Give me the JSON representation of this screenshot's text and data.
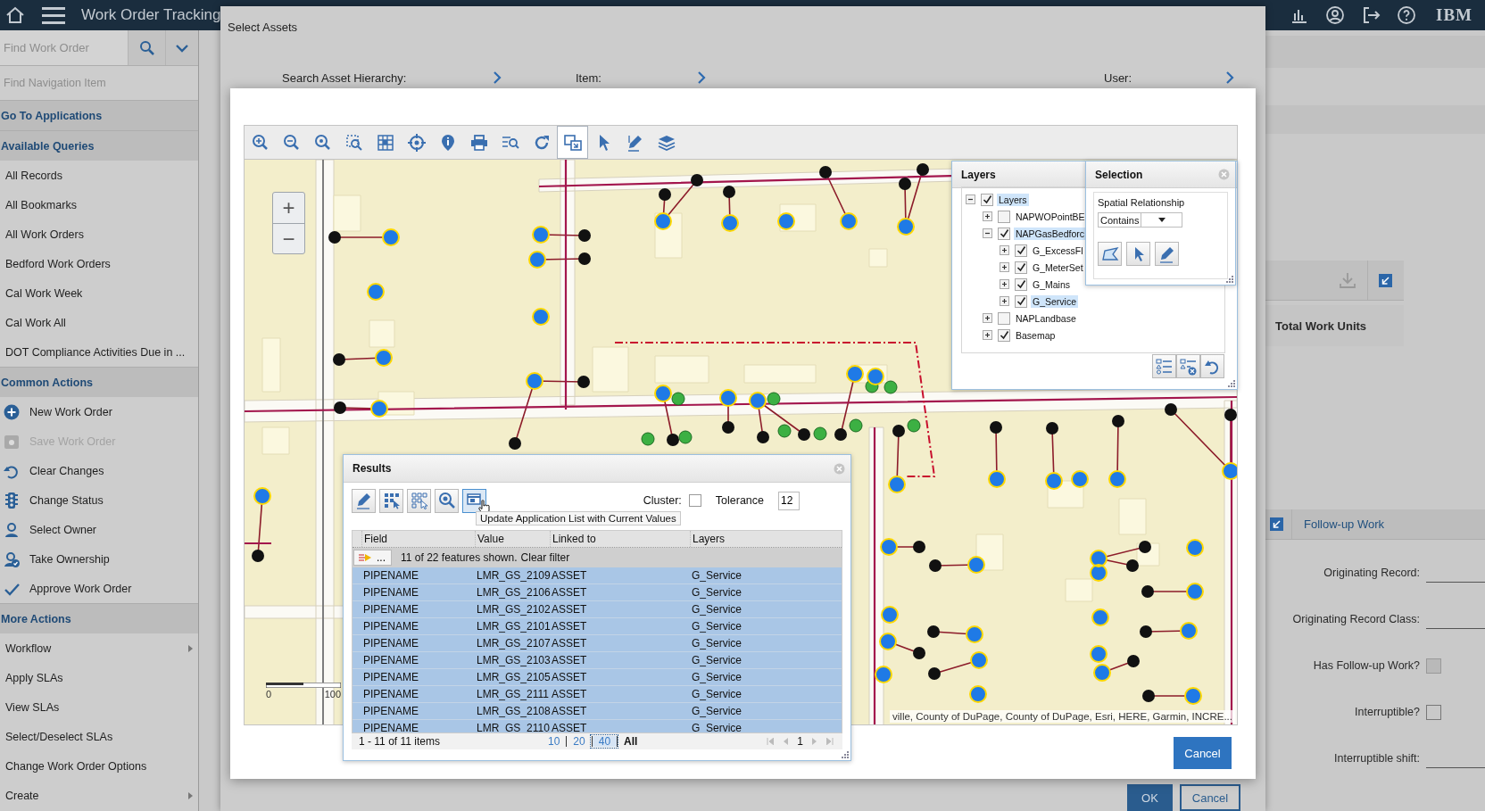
{
  "app": {
    "title": "Work Order Tracking",
    "search": {
      "placeholder": "Find Work Order"
    },
    "logo": "IBM"
  },
  "sidebar": {
    "search": {
      "placeholder": "Find Navigation Item"
    },
    "sections": [
      {
        "title": "Go To Applications"
      },
      {
        "title": "Available Queries",
        "items": [
          {
            "label": "All Records"
          },
          {
            "label": "All Bookmarks"
          },
          {
            "label": "All Work Orders"
          },
          {
            "label": "Bedford Work Orders"
          },
          {
            "label": "Cal Work Week"
          },
          {
            "label": "Cal Work All"
          },
          {
            "label": "DOT Compliance Activities Due in ..."
          }
        ]
      },
      {
        "title": "Common Actions",
        "items": [
          {
            "label": "New Work Order",
            "kind": "action",
            "disabled": false
          },
          {
            "label": "Save Work Order",
            "kind": "action",
            "disabled": true
          },
          {
            "label": "Clear Changes",
            "kind": "action",
            "disabled": false
          },
          {
            "label": "Change Status",
            "kind": "action",
            "disabled": false
          },
          {
            "label": "Select Owner",
            "kind": "action",
            "disabled": false
          },
          {
            "label": "Take Ownership",
            "kind": "action",
            "disabled": false
          },
          {
            "label": "Approve Work Order",
            "kind": "action",
            "disabled": false
          }
        ]
      },
      {
        "title": "More Actions",
        "items": [
          {
            "label": "Workflow",
            "submenu": true
          },
          {
            "label": "Apply SLAs",
            "submenu": false
          },
          {
            "label": "View SLAs",
            "submenu": false
          },
          {
            "label": "Select/Deselect SLAs",
            "submenu": false
          },
          {
            "label": "Change Work Order Options",
            "submenu": false
          },
          {
            "label": "Create",
            "submenu": true
          }
        ]
      }
    ]
  },
  "main": {
    "total_work_units": "Total Work Units",
    "section_title": "Follow-up Work",
    "fields": [
      {
        "label": "Originating Record:",
        "kind": "text",
        "disabled": false
      },
      {
        "label": "Originating Record Class:",
        "kind": "text",
        "disabled": false
      },
      {
        "label": "Has Follow-up Work?",
        "kind": "checkbox",
        "checked": false,
        "disabled": true
      },
      {
        "label": "Interruptible?",
        "kind": "checkbox",
        "checked": false,
        "disabled": false
      },
      {
        "label": "Interruptible shift:",
        "kind": "text",
        "disabled": false
      }
    ]
  },
  "dialog": {
    "title": "Select Assets",
    "fields": [
      {
        "label": "Search Asset Hierarchy:"
      },
      {
        "label": "Item:"
      },
      {
        "label": "User:"
      }
    ],
    "buttons": [
      {
        "label": "OK",
        "kind": "primary"
      },
      {
        "label": "Cancel",
        "kind": "secondary"
      }
    ]
  },
  "asset_picker": {
    "tools": [
      {
        "selected": false
      },
      {
        "selected": false
      },
      {
        "selected": false
      },
      {
        "selected": false
      },
      {
        "selected": false
      },
      {
        "selected": false
      },
      {
        "selected": false
      },
      {
        "selected": false
      },
      {
        "selected": false
      },
      {
        "selected": false
      },
      {
        "selected": true
      },
      {
        "selected": false
      },
      {
        "selected": false
      },
      {
        "selected": false
      }
    ],
    "zoom_buttons": [
      "+",
      "−"
    ],
    "scale_labels": [
      "0",
      "100"
    ],
    "attribution": "ville, County of DuPage, County of DuPage, Esri, HERE, Garmin, INCRE...",
    "layers": {
      "title": "Layers",
      "tree": [
        {
          "label": "Layers",
          "checked": true,
          "expanded": true,
          "selected": true,
          "children": [
            {
              "label": "NAPWOPointBE",
              "checked": false,
              "expanded": false,
              "selected": false
            },
            {
              "label": "NAPGasBedforc",
              "checked": true,
              "expanded": true,
              "selected": true,
              "children": [
                {
                  "label": "G_ExcessFl",
                  "checked": true,
                  "expanded": false,
                  "selected": false
                },
                {
                  "label": "G_MeterSet",
                  "checked": true,
                  "expanded": false,
                  "selected": false
                },
                {
                  "label": "G_Mains",
                  "checked": true,
                  "expanded": false,
                  "selected": false
                },
                {
                  "label": "G_Service",
                  "checked": true,
                  "expanded": false,
                  "selected": true
                }
              ]
            },
            {
              "label": "NAPLandbase",
              "checked": false,
              "expanded": false,
              "selected": false
            },
            {
              "label": "Basemap",
              "checked": true,
              "expanded": false,
              "selected": false
            }
          ]
        }
      ]
    },
    "selection": {
      "title": "Selection",
      "label": "Spatial Relationship",
      "value": "Contains"
    },
    "results": {
      "title": "Results",
      "tools": [
        {
          "hovered": false
        },
        {
          "hovered": false
        },
        {
          "hovered": false
        },
        {
          "hovered": false
        },
        {
          "hovered": true
        }
      ],
      "cluster": {
        "label": "Cluster:",
        "checked": false
      },
      "tolerance": {
        "label": "Tolerance",
        "value": "12"
      },
      "tooltip": "Update Application List with Current Values",
      "columns": [
        "Field",
        "Value",
        "Linked to",
        "Layers"
      ],
      "filter": {
        "button": "...",
        "text": "11 of 22 features shown.",
        "link": "Clear filter"
      },
      "rows": [
        {
          "cells": [
            "PIPENAME",
            "LMR_GS_2109",
            "ASSET",
            "G_Service"
          ],
          "selected": true
        },
        {
          "cells": [
            "PIPENAME",
            "LMR_GS_2106",
            "ASSET",
            "G_Service"
          ],
          "selected": true
        },
        {
          "cells": [
            "PIPENAME",
            "LMR_GS_2102",
            "ASSET",
            "G_Service"
          ],
          "selected": true
        },
        {
          "cells": [
            "PIPENAME",
            "LMR_GS_2101",
            "ASSET",
            "G_Service"
          ],
          "selected": true
        },
        {
          "cells": [
            "PIPENAME",
            "LMR_GS_2107",
            "ASSET",
            "G_Service"
          ],
          "selected": true
        },
        {
          "cells": [
            "PIPENAME",
            "LMR_GS_2103",
            "ASSET",
            "G_Service"
          ],
          "selected": true
        },
        {
          "cells": [
            "PIPENAME",
            "LMR_GS_2105",
            "ASSET",
            "G_Service"
          ],
          "selected": true
        },
        {
          "cells": [
            "PIPENAME",
            "LMR_GS_2111",
            "ASSET",
            "G_Service"
          ],
          "selected": true
        },
        {
          "cells": [
            "PIPENAME",
            "LMR_GS_2108",
            "ASSET",
            "G_Service"
          ],
          "selected": true
        },
        {
          "cells": [
            "PIPENAME",
            "LMR_GS_2110",
            "ASSET",
            "G_Service"
          ],
          "selected": true
        }
      ],
      "footer": {
        "summary": "1 - 11 of 11 items",
        "page_sizes": [
          {
            "label": "10",
            "selected": false,
            "focused": false
          },
          {
            "label": "20",
            "selected": false,
            "focused": false
          },
          {
            "label": "40",
            "selected": false,
            "focused": true
          },
          {
            "label": "All",
            "selected": true,
            "focused": false
          }
        ],
        "page": "1"
      }
    },
    "buttons": [
      {
        "label": "Cancel",
        "kind": "primary"
      }
    ]
  }
}
